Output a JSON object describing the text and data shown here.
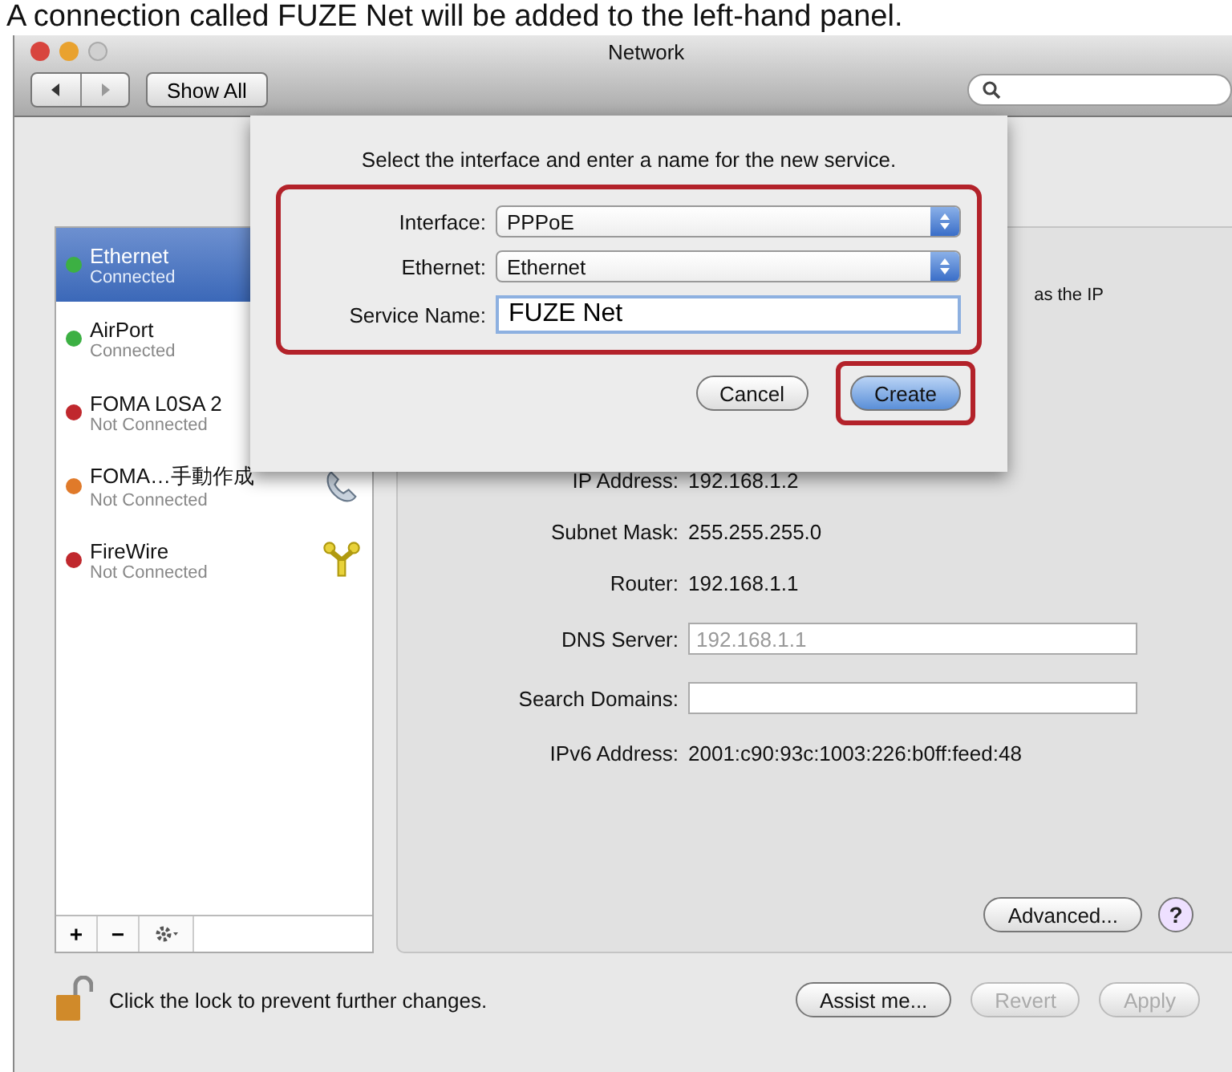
{
  "caption": "A connection called FUZE Net will be added to the left-hand panel.",
  "window": {
    "title": "Network",
    "show_all": "Show All"
  },
  "services": [
    {
      "name": "Ethernet",
      "status": "Connected",
      "color": "#3cb043",
      "selected": true,
      "kind": "plain"
    },
    {
      "name": "AirPort",
      "status": "Connected",
      "color": "#3cb043",
      "selected": false,
      "kind": "plain"
    },
    {
      "name": "FOMA L0SA 2",
      "status": "Not Connected",
      "color": "#c0282d",
      "selected": false,
      "kind": "plain"
    },
    {
      "name": "FOMA…手動作成",
      "status": "Not Connected",
      "color": "#e07a2a",
      "selected": false,
      "kind": "phone"
    },
    {
      "name": "FireWire",
      "status": "Not Connected",
      "color": "#c0282d",
      "selected": false,
      "kind": "firewire"
    }
  ],
  "list_buttons": [
    "+",
    "−"
  ],
  "sheet": {
    "prompt": "Select the interface and enter a name for the new service.",
    "highlighted": true,
    "fields": [
      {
        "kind": "select",
        "label": "Interface:",
        "value": "PPPoE"
      },
      {
        "kind": "select",
        "label": "Ethernet:",
        "value": "Ethernet"
      },
      {
        "kind": "text",
        "label": "Service Name:",
        "value": "FUZE Net"
      }
    ],
    "buttons": [
      {
        "label": "Cancel",
        "default": false,
        "highlighted": false
      },
      {
        "label": "Create",
        "default": true,
        "highlighted": true
      }
    ]
  },
  "panel": {
    "partial_text": "as the IP",
    "rows": [
      {
        "kind": "text",
        "label": "IP Address:",
        "value": "192.168.1.2"
      },
      {
        "kind": "text",
        "label": "Subnet Mask:",
        "value": "255.255.255.0"
      },
      {
        "kind": "text",
        "label": "Router:",
        "value": "192.168.1.1"
      },
      {
        "kind": "field",
        "label": "DNS Server:",
        "placeholder": "192.168.1.1"
      },
      {
        "kind": "field",
        "label": "Search Domains:"
      },
      {
        "kind": "text",
        "label": "IPv6 Address:",
        "value": "2001:c90:93c:1003:226:b0ff:feed:48"
      }
    ],
    "advanced": "Advanced...",
    "help": "?"
  },
  "footer": {
    "lock_text": "Click the lock to prevent further changes.",
    "buttons": [
      {
        "label": "Assist me...",
        "disabled": false
      },
      {
        "label": "Revert",
        "disabled": true
      },
      {
        "label": "Apply",
        "disabled": true
      }
    ]
  }
}
